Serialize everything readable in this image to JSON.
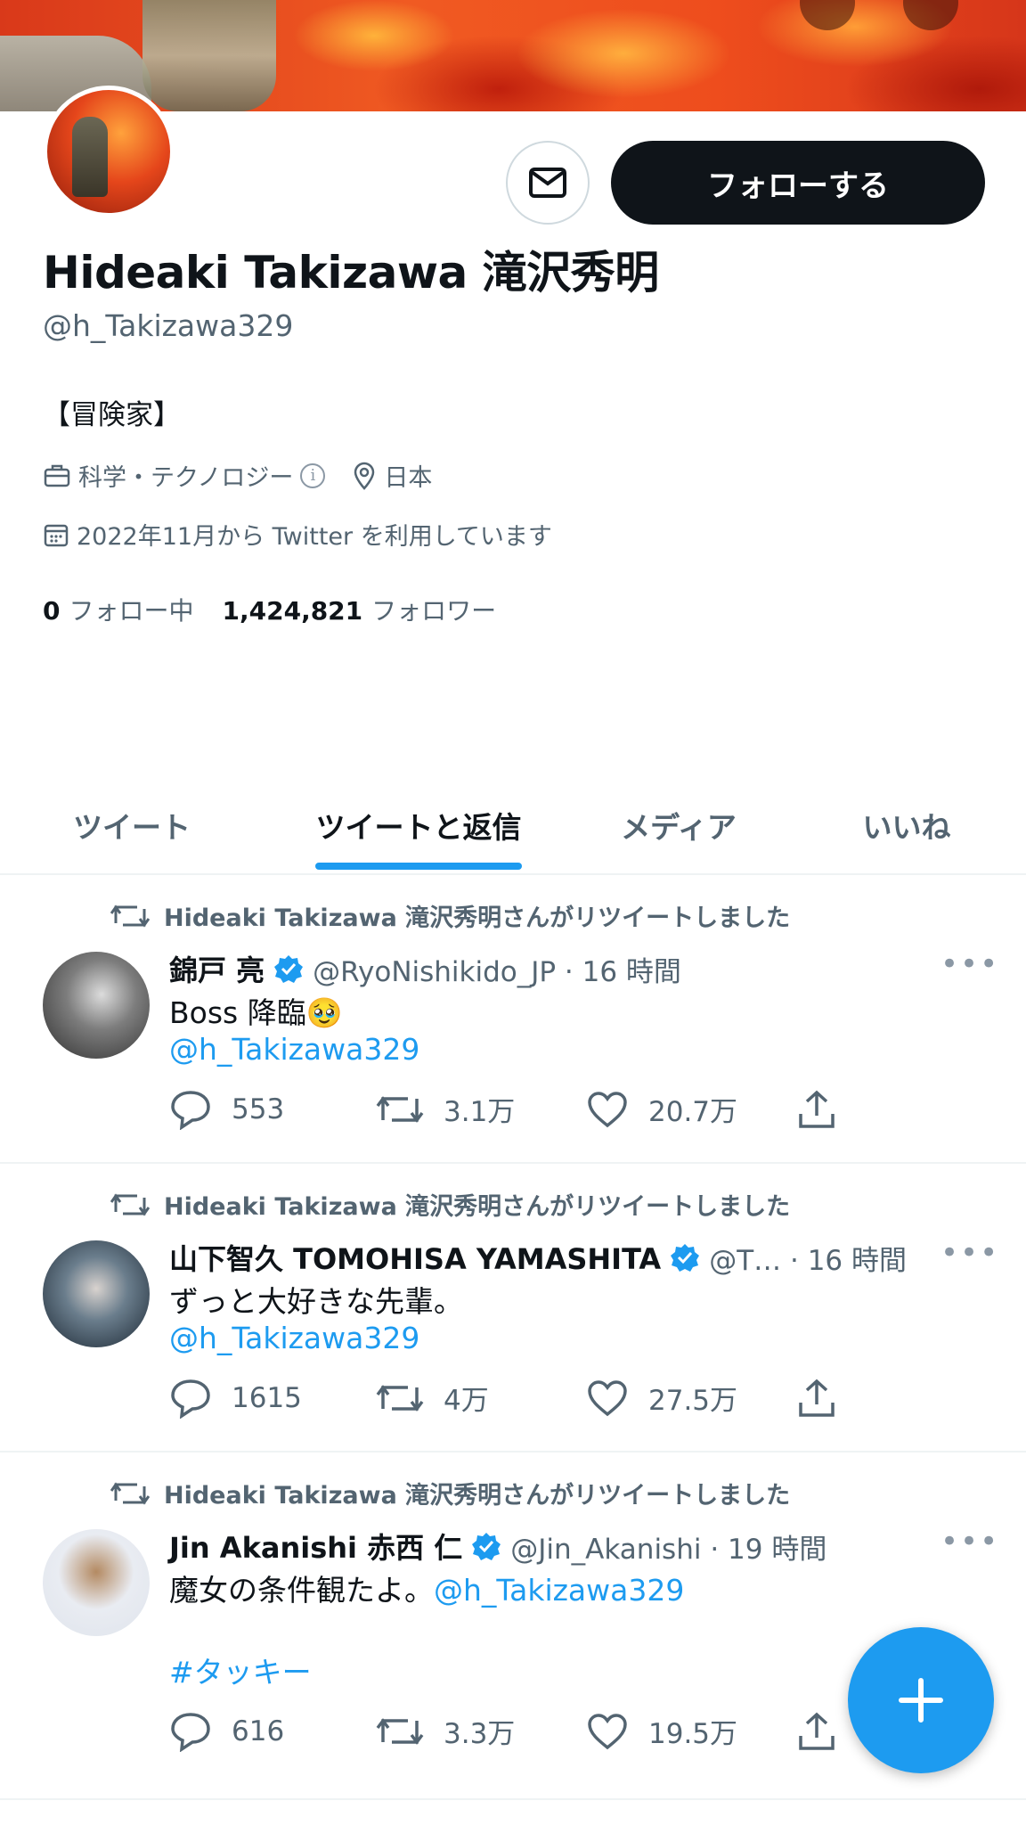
{
  "profile": {
    "display_name": "Hideaki Takizawa 滝沢秀明",
    "handle": "@h_Takizawa329",
    "bio": "【冒険家】",
    "category": "科学・テクノロジー",
    "location": "日本",
    "joined": "2022年11月から Twitter を利用しています",
    "following_count": "0",
    "following_label": "フォロー中",
    "followers_count": "1,424,821",
    "followers_label": "フォロワー",
    "follow_button": "フォローする"
  },
  "tabs": [
    "ツイート",
    "ツイートと返信",
    "メディア",
    "いいね"
  ],
  "active_tab": "ツイートと返信",
  "tweets": [
    {
      "retweet_note": "Hideaki Takizawa 滝沢秀明さんがリツイートしました",
      "name": "錦戸 亮",
      "handle_time": "@RyoNishikido_JP · 16 時間",
      "text": "Boss 降臨🥹",
      "mention": "@h_Takizawa329",
      "replies": "553",
      "retweets": "3.1万",
      "likes": "20.7万"
    },
    {
      "retweet_note": "Hideaki Takizawa 滝沢秀明さんがリツイートしました",
      "name": "山下智久 TOMOHISA YAMASHITA",
      "handle_time": "@T… · 16 時間",
      "text": "ずっと大好きな先輩。",
      "mention": "@h_Takizawa329",
      "replies": "1615",
      "retweets": "4万",
      "likes": "27.5万"
    },
    {
      "retweet_note": "Hideaki Takizawa 滝沢秀明さんがリツイートしました",
      "name": "Jin Akanishi  赤西 仁",
      "handle_time": "@Jin_Akanishi · 19 時間",
      "text": "魔女の条件観たよ。",
      "mention": "@h_Takizawa329",
      "hashtag": "#タッキー",
      "replies": "616",
      "retweets": "3.3万",
      "likes": "19.5万"
    }
  ],
  "colors": {
    "accent": "#1d9bf0",
    "text_primary": "#0f1419",
    "text_secondary": "#536471"
  }
}
